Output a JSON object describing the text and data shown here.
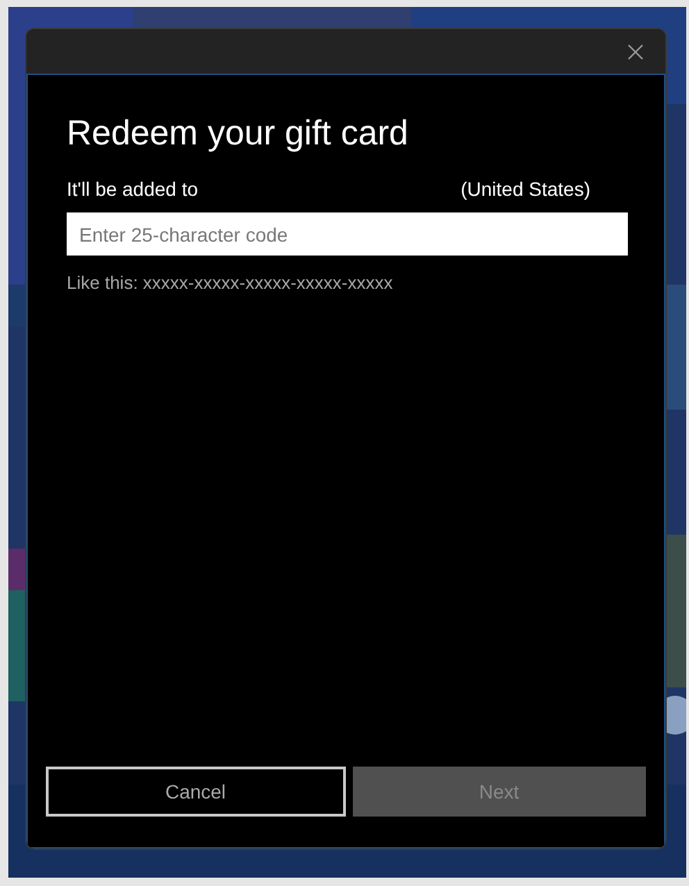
{
  "dialog": {
    "title": "Redeem your gift card",
    "account_label": "It'll be added to",
    "account_region": "(United States)",
    "code_field": {
      "placeholder": "Enter 25-character code"
    },
    "hint": "Like this: xxxxx-xxxxx-xxxxx-xxxxx-xxxxx",
    "buttons": [
      {
        "label": "Cancel",
        "disabled": false
      },
      {
        "label": "Next",
        "disabled": true
      }
    ]
  }
}
